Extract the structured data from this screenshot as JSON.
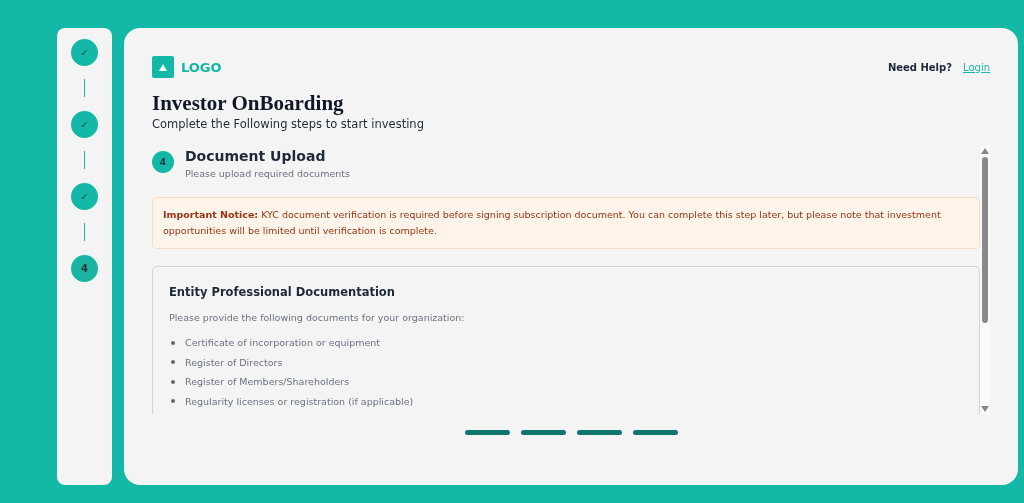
{
  "steps": [
    {
      "label": "✓",
      "done": true
    },
    {
      "label": "✓",
      "done": true
    },
    {
      "label": "✓",
      "done": true
    },
    {
      "label": "4",
      "done": false
    }
  ],
  "header": {
    "logo_text": "LOGO",
    "help_text": "Need Help?",
    "login_link": "Login"
  },
  "title": "Investor OnBoarding",
  "subtitle": "Complete the Following steps to start investing",
  "current_step": {
    "number": "4",
    "title": "Document Upload",
    "description": "Please upload required documents"
  },
  "notice": {
    "text": "**Important Notice:** KYC document verification is required before signing subscription document. You can complete this step later, but please note that investment opportunities will be limited until verification is complete."
  },
  "documentation": {
    "title": "Entity Professional Documentation",
    "intro": "Please provide the following documents for your organization:",
    "items": [
      "Certificate of incorporation or equipment",
      "Register of Directors",
      "Register of Members/Shareholders",
      "Regularity licenses or registration (if applicable)"
    ]
  },
  "progress": [
    {
      "filled": true
    },
    {
      "filled": true
    },
    {
      "filled": true
    },
    {
      "filled": true
    }
  ]
}
